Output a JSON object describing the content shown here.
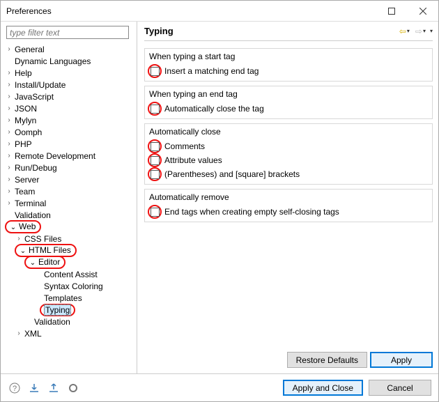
{
  "window": {
    "title": "Preferences"
  },
  "filter": {
    "placeholder": "type filter text"
  },
  "tree": {
    "general": "General",
    "dynlang": "Dynamic Languages",
    "help": "Help",
    "install": "Install/Update",
    "javascript": "JavaScript",
    "json": "JSON",
    "mylyn": "Mylyn",
    "oomph": "Oomph",
    "php": "PHP",
    "remote": "Remote Development",
    "rundebug": "Run/Debug",
    "server": "Server",
    "team": "Team",
    "terminal": "Terminal",
    "validation": "Validation",
    "web": "Web",
    "cssfiles": "CSS Files",
    "htmlfiles": "HTML Files",
    "editor": "Editor",
    "contentassist": "Content Assist",
    "syntax": "Syntax Coloring",
    "templates": "Templates",
    "typing": "Typing",
    "validation2": "Validation",
    "xml": "XML"
  },
  "page": {
    "title": "Typing",
    "groups": {
      "start": {
        "title": "When typing a start tag",
        "opt1": "Insert a matching end tag"
      },
      "end": {
        "title": "When typing an end tag",
        "opt1": "Automatically close the tag"
      },
      "close": {
        "title": "Automatically close",
        "opt1": "Comments",
        "opt2": "Attribute values",
        "opt3": "(Parentheses) and [square] brackets"
      },
      "remove": {
        "title": "Automatically remove",
        "opt1": "End tags when creating empty self-closing tags"
      }
    }
  },
  "buttons": {
    "restore": "Restore Defaults",
    "apply": "Apply",
    "applyclose": "Apply and Close",
    "cancel": "Cancel"
  }
}
